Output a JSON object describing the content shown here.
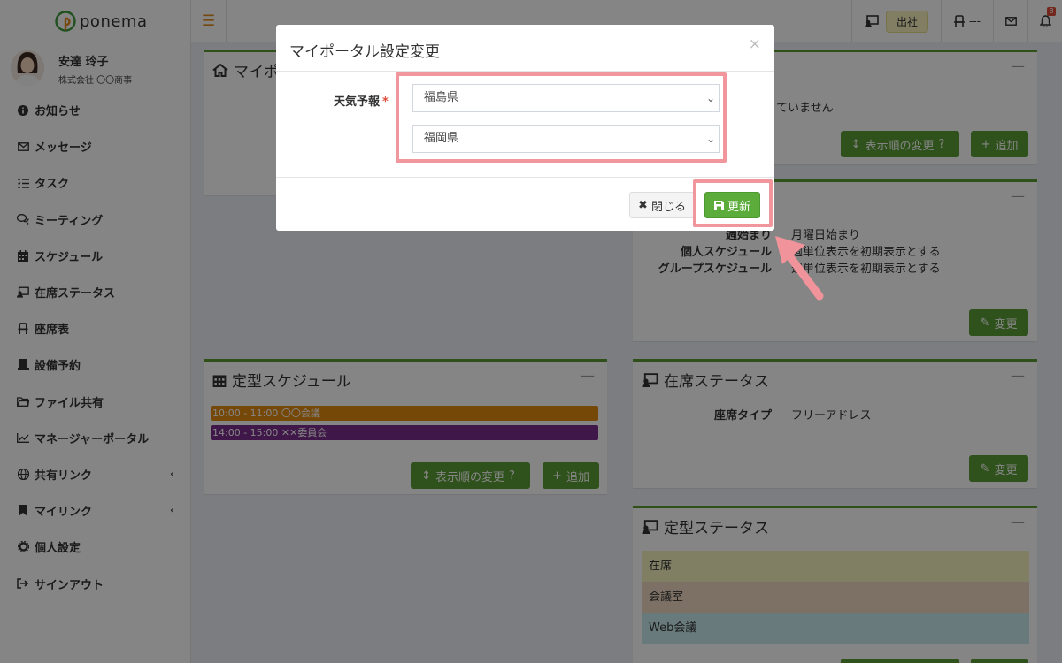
{
  "app": {
    "name": "ponema"
  },
  "header": {
    "attendance_status": "出社",
    "seat_value": "---",
    "notification_count": "8"
  },
  "user": {
    "name": "安達 玲子",
    "company": "株式会社 〇〇商事"
  },
  "sidebar": {
    "items": [
      {
        "label": "お知らせ",
        "icon": "info-circle-icon"
      },
      {
        "label": "メッセージ",
        "icon": "envelope-icon"
      },
      {
        "label": "タスク",
        "icon": "list-check-icon"
      },
      {
        "label": "ミーティング",
        "icon": "comments-icon"
      },
      {
        "label": "スケジュール",
        "icon": "calendar-icon"
      },
      {
        "label": "在席ステータス",
        "icon": "presence-icon"
      },
      {
        "label": "座席表",
        "icon": "chair-icon"
      },
      {
        "label": "設備予約",
        "icon": "facility-icon"
      },
      {
        "label": "ファイル共有",
        "icon": "folder-icon"
      },
      {
        "label": "マネージャーポータル",
        "icon": "line-chart-icon"
      },
      {
        "label": "共有リンク",
        "icon": "globe-icon"
      },
      {
        "label": "マイリンク",
        "icon": "bookmark-icon"
      },
      {
        "label": "個人設定",
        "icon": "gear-icon"
      },
      {
        "label": "サインアウト",
        "icon": "sign-out-icon"
      }
    ]
  },
  "panels": {
    "myportal": {
      "title": "マイポ"
    },
    "topright": {
      "message_fragment": "ていません",
      "reorder_label": "表示順の変更",
      "add_label": "追加"
    },
    "schedule_settings": {
      "rows": [
        {
          "label": "週始まり",
          "value": "月曜日始まり"
        },
        {
          "label": "個人スケジュール",
          "value": "週単位表示を初期表示とする"
        },
        {
          "label": "グループスケジュール",
          "value": "週単位表示を初期表示とする"
        }
      ],
      "edit_label": "変更"
    },
    "fixed_schedule": {
      "title": "定型スケジュール",
      "items": [
        {
          "text": "10:00 - 11:00 〇〇会議",
          "color": "#e08b11"
        },
        {
          "text": "14:00 - 15:00 ✕✕委員会",
          "color": "#7a2d8c"
        }
      ],
      "reorder_label": "表示順の変更",
      "add_label": "追加"
    },
    "presence_status": {
      "title": "在席ステータス",
      "seat_type_label": "座席タイプ",
      "seat_type_value": "フリーアドレス",
      "edit_label": "変更"
    },
    "fixed_status": {
      "title": "定型ステータス",
      "items": [
        {
          "text": "在席",
          "color": "#f5f3c0"
        },
        {
          "text": "会議室",
          "color": "#f0d9c4"
        },
        {
          "text": "Web会議",
          "color": "#c8eaec"
        }
      ]
    }
  },
  "modal": {
    "title": "マイポータル設定変更",
    "field_label": "天気予報",
    "required_mark": "*",
    "selects": [
      {
        "value": "福島県"
      },
      {
        "value": "福岡県"
      }
    ],
    "close_label": "閉じる",
    "update_label": "更新"
  },
  "colors": {
    "accent": "#5b9a31",
    "highlight": "#f1969c",
    "required": "#dd4b39"
  }
}
